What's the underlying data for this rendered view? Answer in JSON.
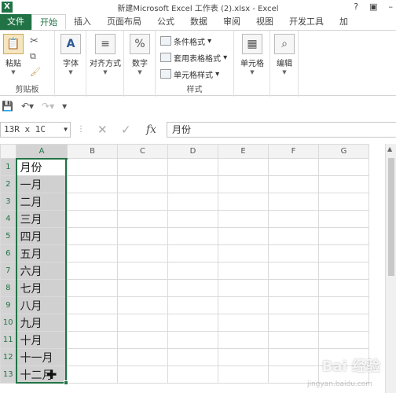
{
  "window": {
    "title": "新建Microsoft Excel 工作表 (2).xlsx - Excel",
    "help_label": "?",
    "logo": "X"
  },
  "ribbon_tabs": [
    "文件",
    "开始",
    "插入",
    "页面布局",
    "公式",
    "数据",
    "审阅",
    "视图",
    "开发工具",
    "加"
  ],
  "ribbon": {
    "clipboard": {
      "paste_label": "粘贴",
      "group_label": "剪贴板"
    },
    "font": {
      "label": "字体"
    },
    "alignment": {
      "label": "对齐方式"
    },
    "number": {
      "label": "数字"
    },
    "styles": {
      "conditional": "条件格式",
      "table_format": "套用表格格式",
      "cell_styles": "单元格样式",
      "group_label": "样式"
    },
    "cells": {
      "label": "单元格"
    },
    "editing": {
      "label": "编辑"
    }
  },
  "formula_bar": {
    "name_box": "13R x 1C",
    "fx_label": "fx",
    "value": "月份"
  },
  "grid": {
    "columns": [
      "A",
      "B",
      "C",
      "D",
      "E",
      "F",
      "G"
    ],
    "rows": [
      "1",
      "2",
      "3",
      "4",
      "5",
      "6",
      "7",
      "8",
      "9",
      "10",
      "11",
      "12",
      "13"
    ],
    "column_a": [
      "月份",
      "一月",
      "二月",
      "三月",
      "四月",
      "五月",
      "六月",
      "七月",
      "八月",
      "九月",
      "十月",
      "十一月",
      "十二月"
    ]
  },
  "watermark": {
    "text": "Bai 经验",
    "sub": "jingyan.baidu.com"
  },
  "colors": {
    "accent": "#217346",
    "selection": "#d0d0d0"
  }
}
